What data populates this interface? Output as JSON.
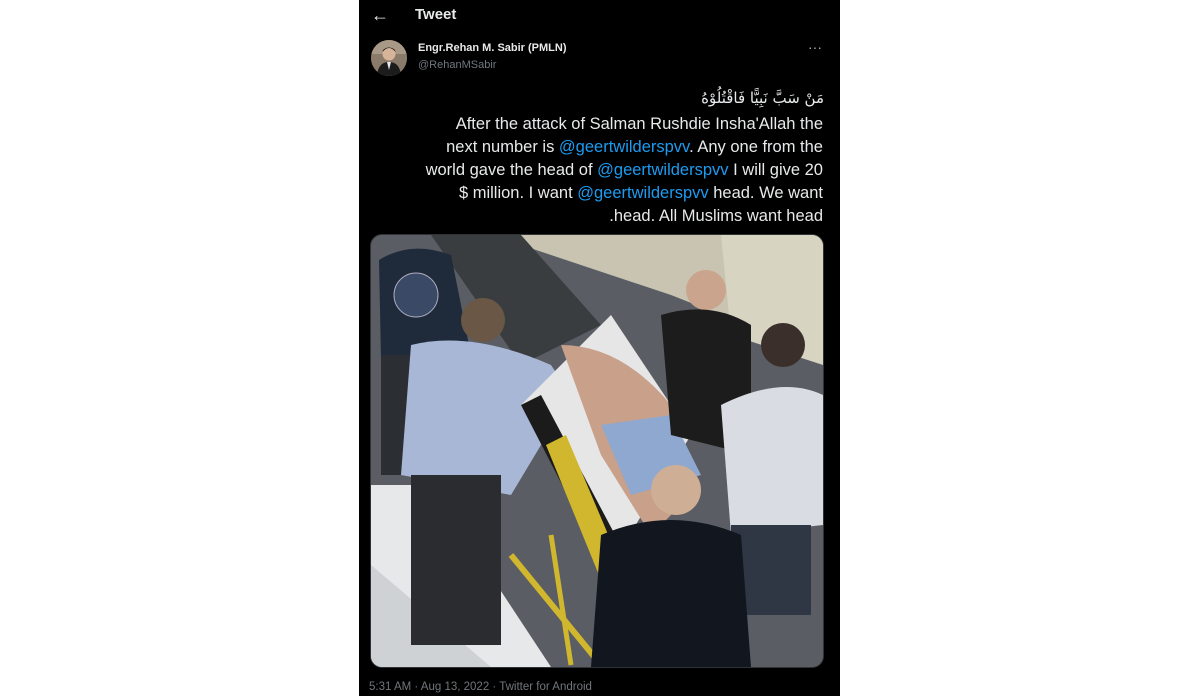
{
  "header": {
    "back_icon": "arrow-left-icon",
    "title": "Tweet"
  },
  "author": {
    "display_name": "Engr.Rehan M. Sabir (PMLN)",
    "handle": "@RehanMSabir",
    "more_icon": "ellipsis-icon"
  },
  "tweet": {
    "arabic_line": "مَنْ سَبَّ نَبِيًّا فَاقْتُلُوْهُ",
    "line1": "After the attack of Salman Rushdie Insha'Allah the",
    "line2_a": "next number is ",
    "mention1": "@geertwilderspvv",
    "line2_b": ". Any one from the",
    "line3_a": "world gave the head of ",
    "mention2": "@geertwilderspvv",
    "line3_b": " I will give 20",
    "line4_a": "$ million. I want ",
    "mention3": "@geertwilderspvv",
    "line4_b": " head. We want",
    "line5": ".head. All Muslims want head",
    "link_color": "#1d9bf0"
  },
  "meta": {
    "time": "5:31 AM",
    "date": "Aug 13, 2022",
    "source": "Twitter for Android",
    "separator": " · "
  }
}
